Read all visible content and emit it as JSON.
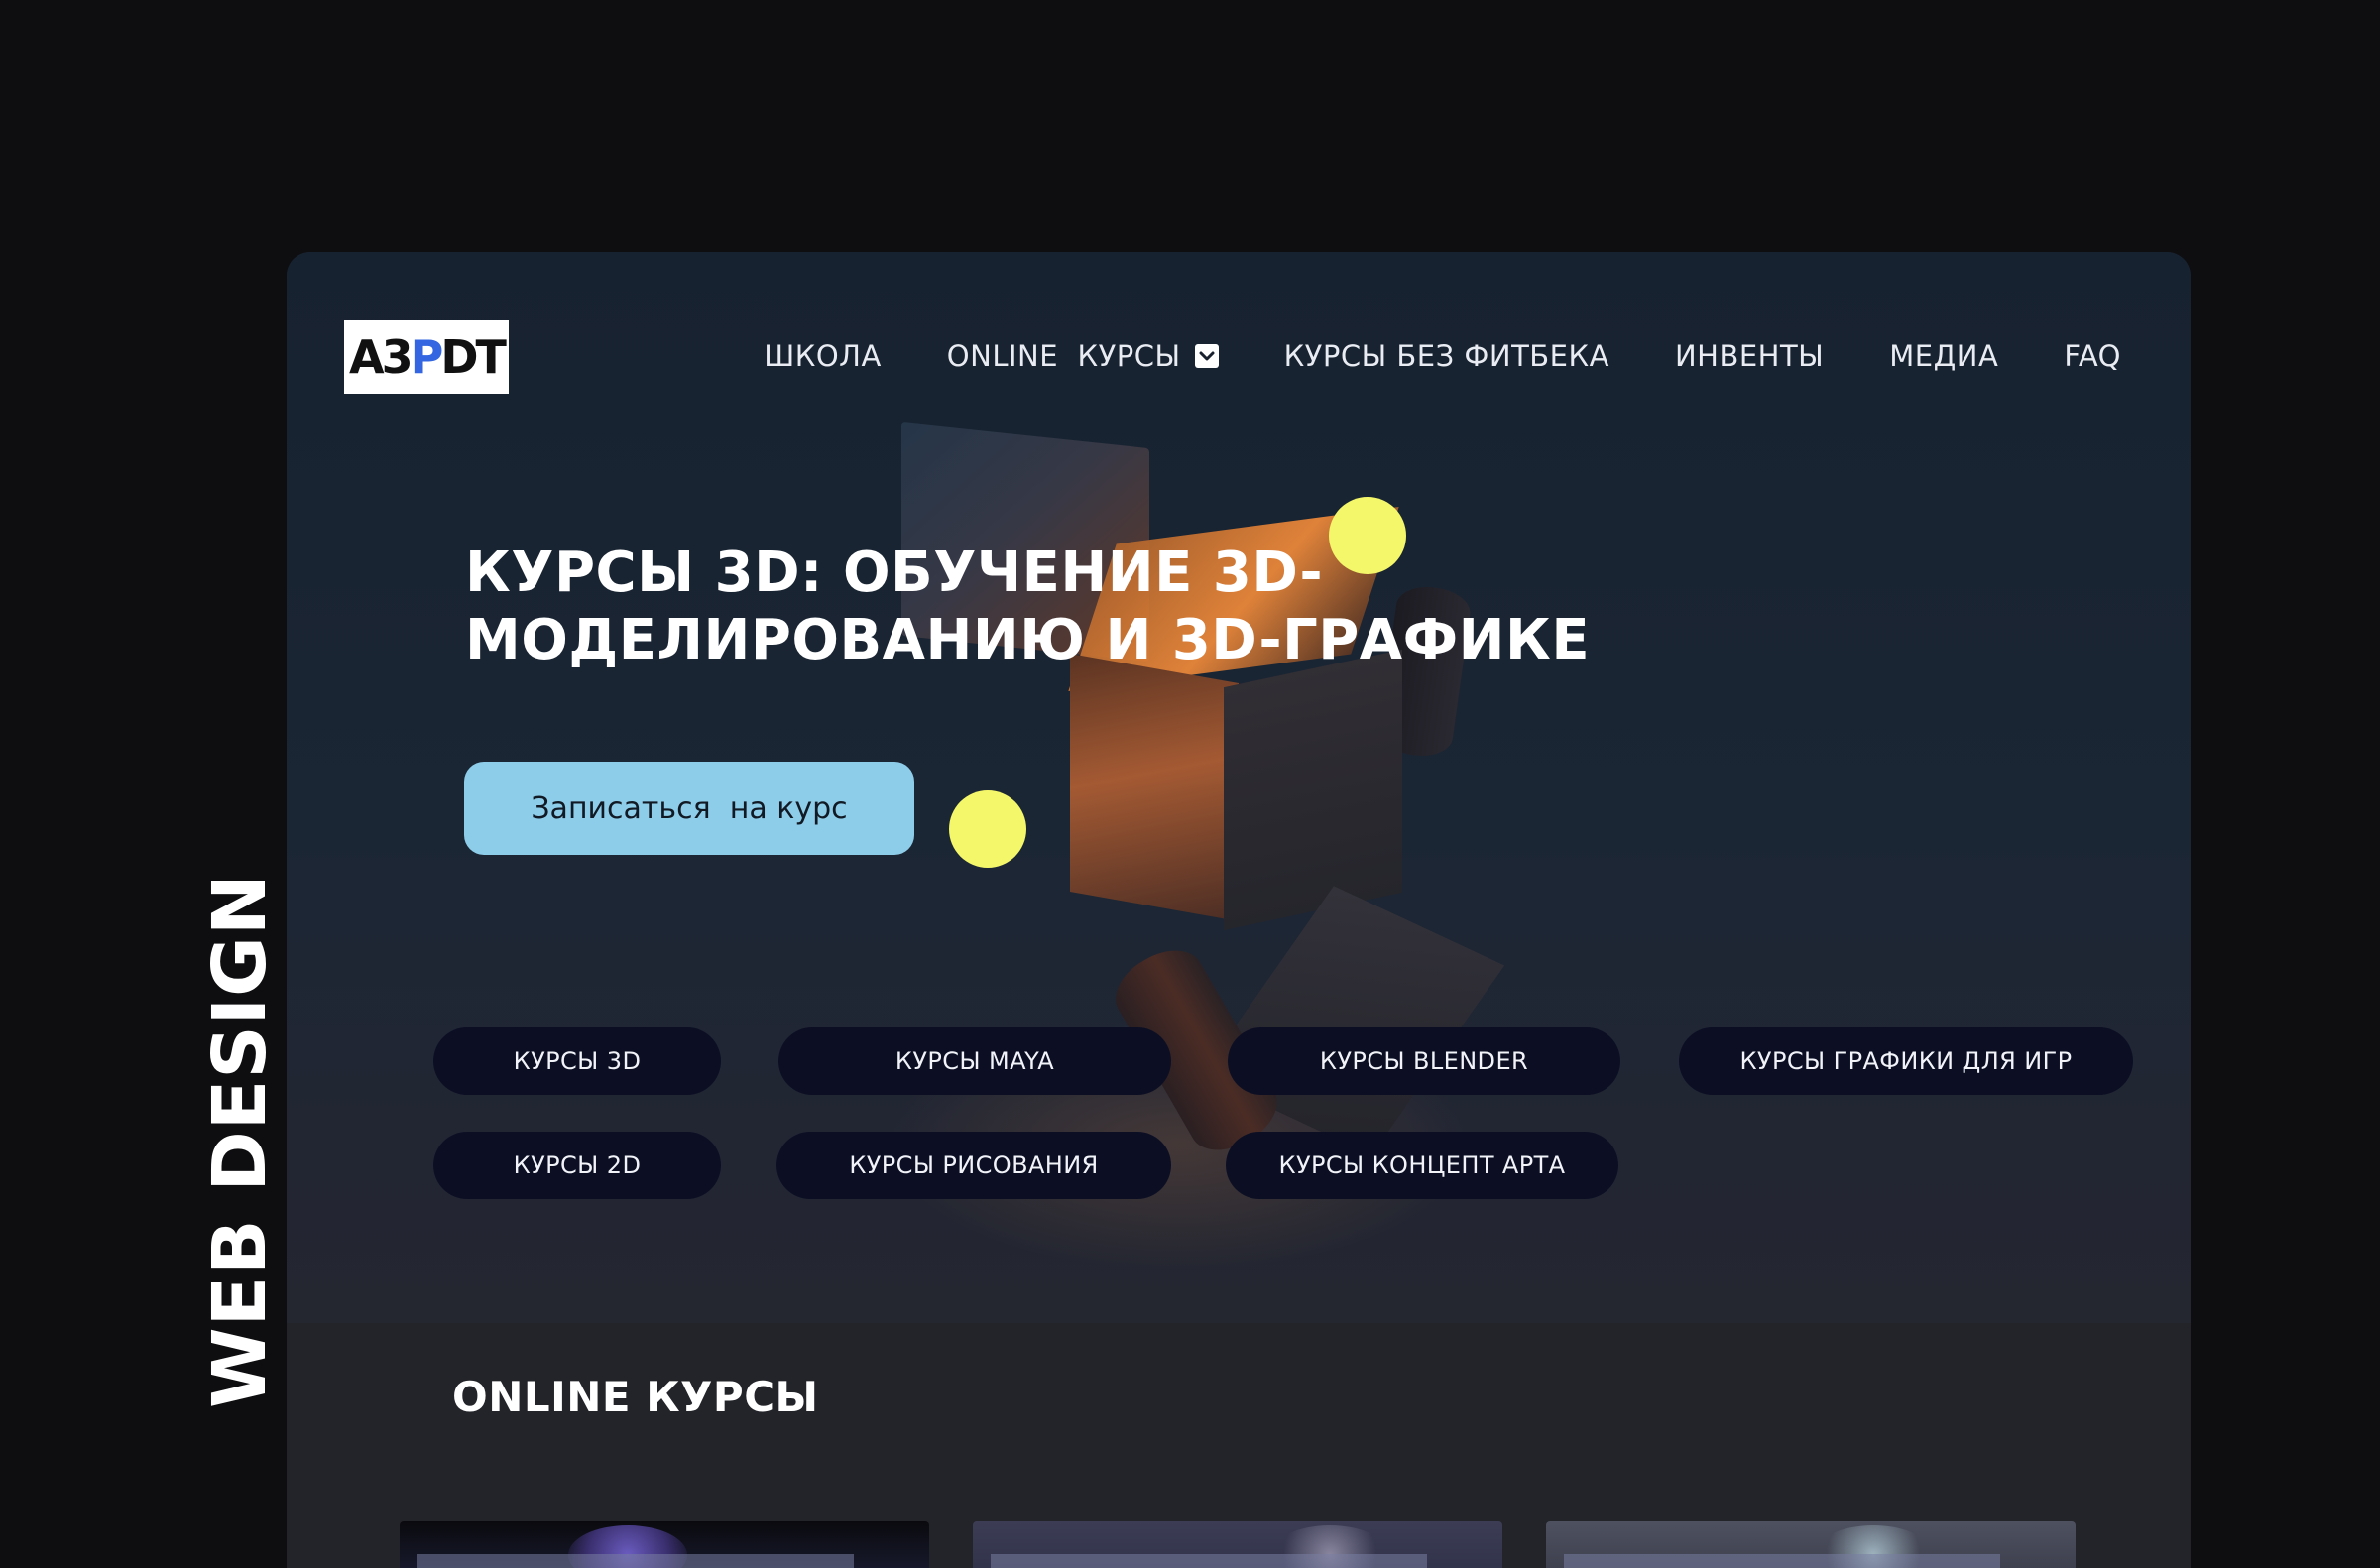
{
  "side_label": "WEB DESIGN",
  "logo": {
    "text_a": "A3",
    "text_b": "P",
    "text_c": "DT"
  },
  "nav": {
    "items": [
      {
        "label": "ШКОЛА"
      },
      {
        "label": "ONLINE  КУРСЫ"
      },
      {
        "label": "КУРСЫ БЕЗ ФИТБЕКА"
      },
      {
        "label": "ИНВЕНТЫ"
      },
      {
        "label": "МЕДИА"
      },
      {
        "label": "FAQ"
      }
    ]
  },
  "hero": {
    "headline_line1": "КУРСЫ 3D: ОБУЧЕНИЕ 3D-",
    "headline_line2": "МОДЕЛИРОВАНИЮ И 3D-ГРАФИКЕ",
    "cta_label": "Записаться  на курс"
  },
  "course_pills": [
    {
      "label": "КУРСЫ 3D"
    },
    {
      "label": "КУРСЫ MAYA"
    },
    {
      "label": "КУРСЫ BLENDER"
    },
    {
      "label": "КУРСЫ ГРАФИКИ ДЛЯ ИГР"
    },
    {
      "label": "КУРСЫ 2D"
    },
    {
      "label": "КУРСЫ РИСОВАНИЯ"
    },
    {
      "label": "КУРСЫ КОНЦЕПТ АРТА"
    }
  ],
  "online_section": {
    "title": "ONLINE КУРСЫ"
  },
  "colors": {
    "background": "#0e0e10",
    "hero_bg": "#18212d",
    "cta": "#8ecde9",
    "pill": "#0c0f24",
    "accent_dot": "#f4f76a",
    "logo_blue": "#3366e0"
  }
}
